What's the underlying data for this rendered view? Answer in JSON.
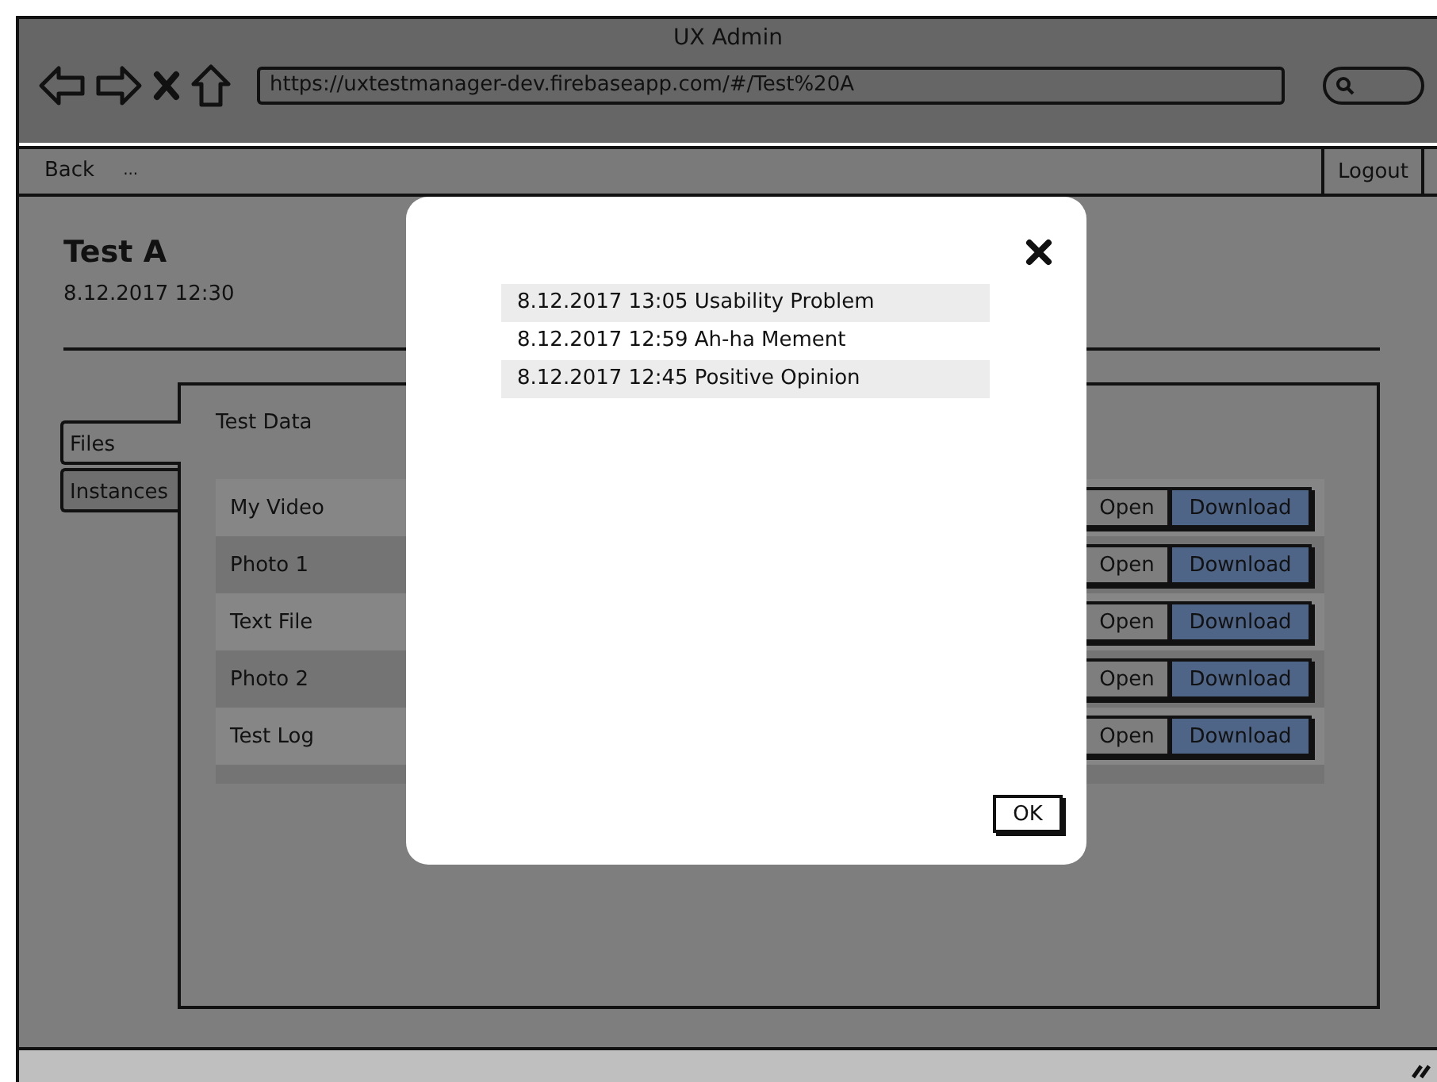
{
  "window": {
    "title": "UX Admin"
  },
  "address_bar": {
    "url": "https://uxtestmanager-dev.firebaseapp.com/#/Test%20A"
  },
  "navbar": {
    "back": "Back",
    "more": "...",
    "logout": "Logout"
  },
  "page": {
    "title": "Test A",
    "date": "8.12.2017 12:30"
  },
  "tabs": [
    {
      "label": "Files",
      "selected": true
    },
    {
      "label": "Instances",
      "selected": false
    }
  ],
  "panel": {
    "title": "Test Data",
    "files": [
      {
        "name": "My Video",
        "open": "Open",
        "download": "Download"
      },
      {
        "name": "Photo 1",
        "open": "Open",
        "download": "Download"
      },
      {
        "name": "Text File",
        "open": "Open",
        "download": "Download"
      },
      {
        "name": "Photo 2",
        "open": "Open",
        "download": "Download"
      },
      {
        "name": "Test Log",
        "open": "Open",
        "download": "Download"
      }
    ]
  },
  "dialog": {
    "events": [
      "8.12.2017 13:05 Usability Problem",
      "8.12.2017 12:59 Ah-ha Mement",
      "8.12.2017 12:45 Positive Opinion"
    ],
    "ok": "OK"
  }
}
